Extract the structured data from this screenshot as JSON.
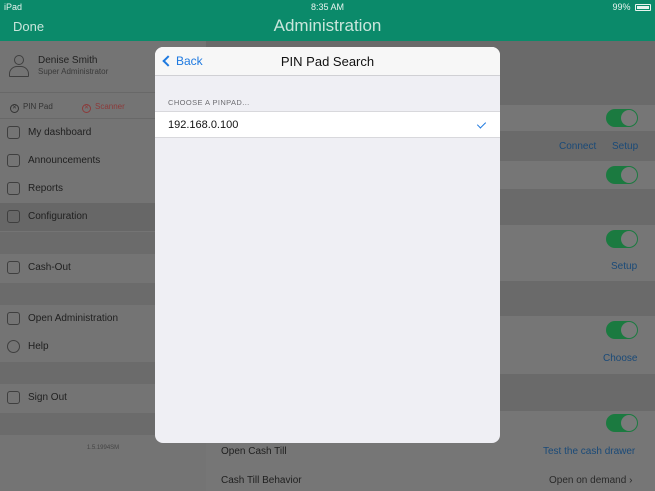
{
  "status": {
    "device": "iPad",
    "time": "8:35 AM",
    "battery": "99%"
  },
  "nav": {
    "done": "Done",
    "title": "Administration"
  },
  "profile": {
    "name": "Denise Smith",
    "role": "Super Administrator"
  },
  "devices": {
    "pinpad": "PIN Pad",
    "scanner": "Scanner"
  },
  "sidebar": {
    "items": [
      {
        "label": "My dashboard",
        "icon": "dashboard-icon"
      },
      {
        "label": "Announcements",
        "icon": "megaphone-icon"
      },
      {
        "label": "Reports",
        "icon": "report-icon"
      },
      {
        "label": "Configuration",
        "icon": "gears-icon"
      },
      {
        "label": "Cash-Out",
        "icon": "piggy-bank-icon"
      },
      {
        "label": "Open Administration",
        "icon": "gear-icon"
      },
      {
        "label": "Help",
        "icon": "help-icon"
      },
      {
        "label": "Sign Out",
        "icon": "sign-out-icon"
      }
    ],
    "version": "1.5.1994SM"
  },
  "content": {
    "connect": "Connect",
    "setup1": "Setup",
    "setup2": "Setup",
    "choose": "Choose",
    "open_cash_till": "Open Cash Till",
    "test_cash_drawer": "Test the cash drawer",
    "cash_till_behavior": "Cash Till Behavior",
    "cash_till_value": "Open on demand"
  },
  "modal": {
    "back": "Back",
    "title": "PIN Pad Search",
    "section": "CHOOSE A PINPAD...",
    "pinpads": [
      {
        "ip": "192.168.0.100",
        "selected": true
      }
    ]
  },
  "colors": {
    "accent": "#1f7ae0",
    "navbar": "#0b8a6a",
    "toggle_on": "#4cd964"
  }
}
